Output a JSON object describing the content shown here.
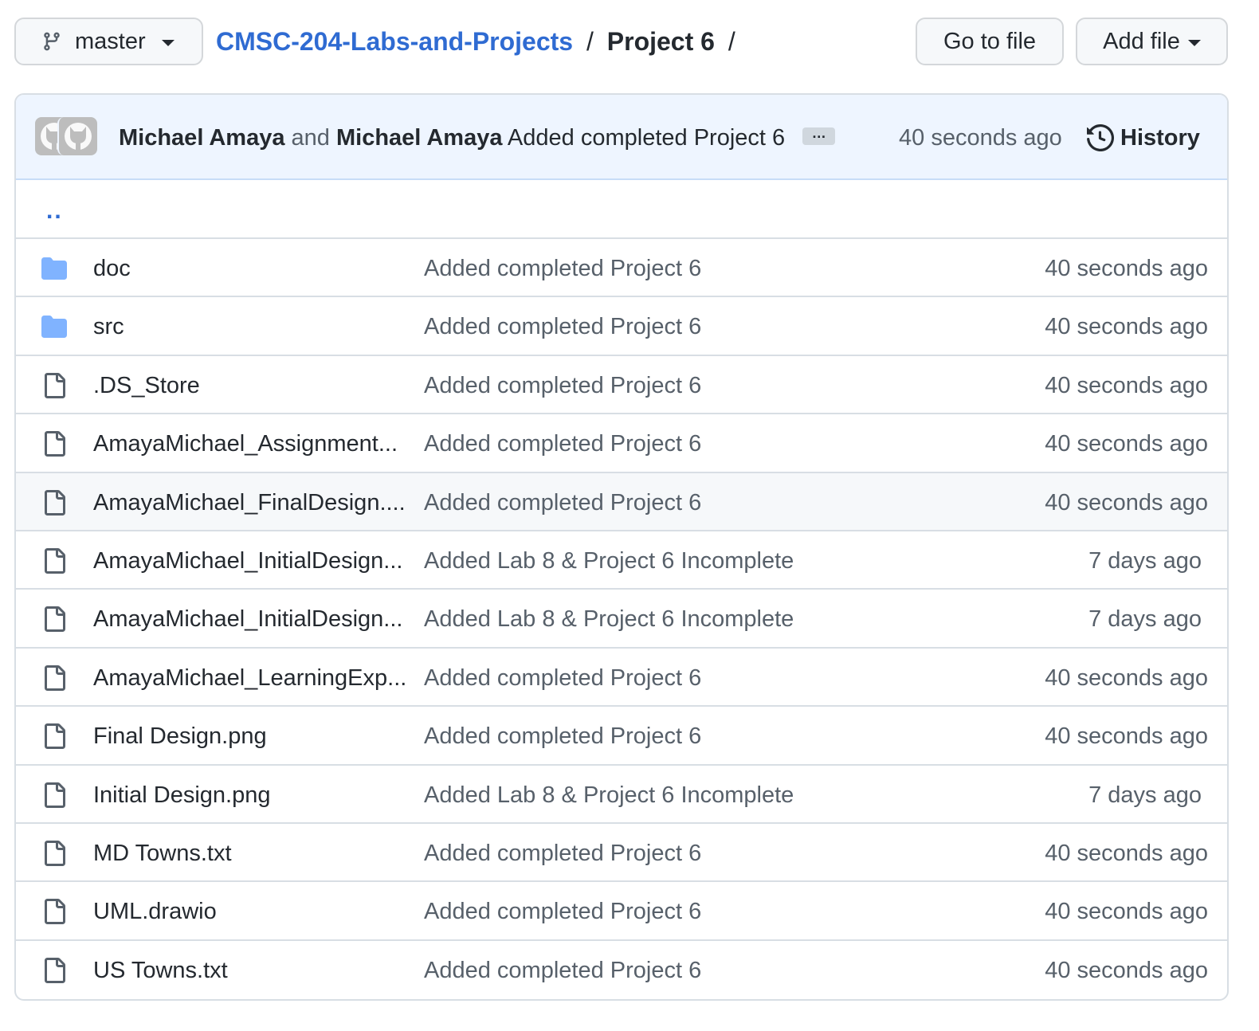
{
  "toolbar": {
    "branch": "master",
    "go_to_file": "Go to file",
    "add_file": "Add file"
  },
  "breadcrumb": {
    "repo": "CMSC-204-Labs-and-Projects",
    "sep1": "/",
    "folder": "Project 6",
    "sep2": "/"
  },
  "commit": {
    "author1": "Michael Amaya",
    "and": "and",
    "author2": "Michael Amaya",
    "message": "Added completed Project 6",
    "ellipsis": "…",
    "time": "40 seconds ago",
    "history": "History"
  },
  "parent_dir": "..",
  "colors": {
    "link": "#2f6bd2",
    "folder": "#80b3ff",
    "muted": "#57606a"
  },
  "files": [
    {
      "name": "doc",
      "type": "folder",
      "message": "Added completed Project 6",
      "time": "40 seconds ago"
    },
    {
      "name": "src",
      "type": "folder",
      "message": "Added completed Project 6",
      "time": "40 seconds ago"
    },
    {
      "name": ".DS_Store",
      "type": "file",
      "message": "Added completed Project 6",
      "time": "40 seconds ago"
    },
    {
      "name": "AmayaMichael_Assignment...",
      "type": "file",
      "message": "Added completed Project 6",
      "time": "40 seconds ago"
    },
    {
      "name": "AmayaMichael_FinalDesign....",
      "type": "file",
      "message": "Added completed Project 6",
      "time": "40 seconds ago",
      "hover": true
    },
    {
      "name": "AmayaMichael_InitialDesign...",
      "type": "file",
      "message": "Added Lab 8 & Project 6 Incomplete",
      "time": "7 days ago"
    },
    {
      "name": "AmayaMichael_InitialDesign...",
      "type": "file",
      "message": "Added Lab 8 & Project 6 Incomplete",
      "time": "7 days ago"
    },
    {
      "name": "AmayaMichael_LearningExp...",
      "type": "file",
      "message": "Added completed Project 6",
      "time": "40 seconds ago"
    },
    {
      "name": "Final Design.png",
      "type": "file",
      "message": "Added completed Project 6",
      "time": "40 seconds ago"
    },
    {
      "name": "Initial Design.png",
      "type": "file",
      "message": "Added Lab 8 & Project 6 Incomplete",
      "time": "7 days ago"
    },
    {
      "name": "MD Towns.txt",
      "type": "file",
      "message": "Added completed Project 6",
      "time": "40 seconds ago"
    },
    {
      "name": "UML.drawio",
      "type": "file",
      "message": "Added completed Project 6",
      "time": "40 seconds ago"
    },
    {
      "name": "US Towns.txt",
      "type": "file",
      "message": "Added completed Project 6",
      "time": "40 seconds ago"
    }
  ]
}
